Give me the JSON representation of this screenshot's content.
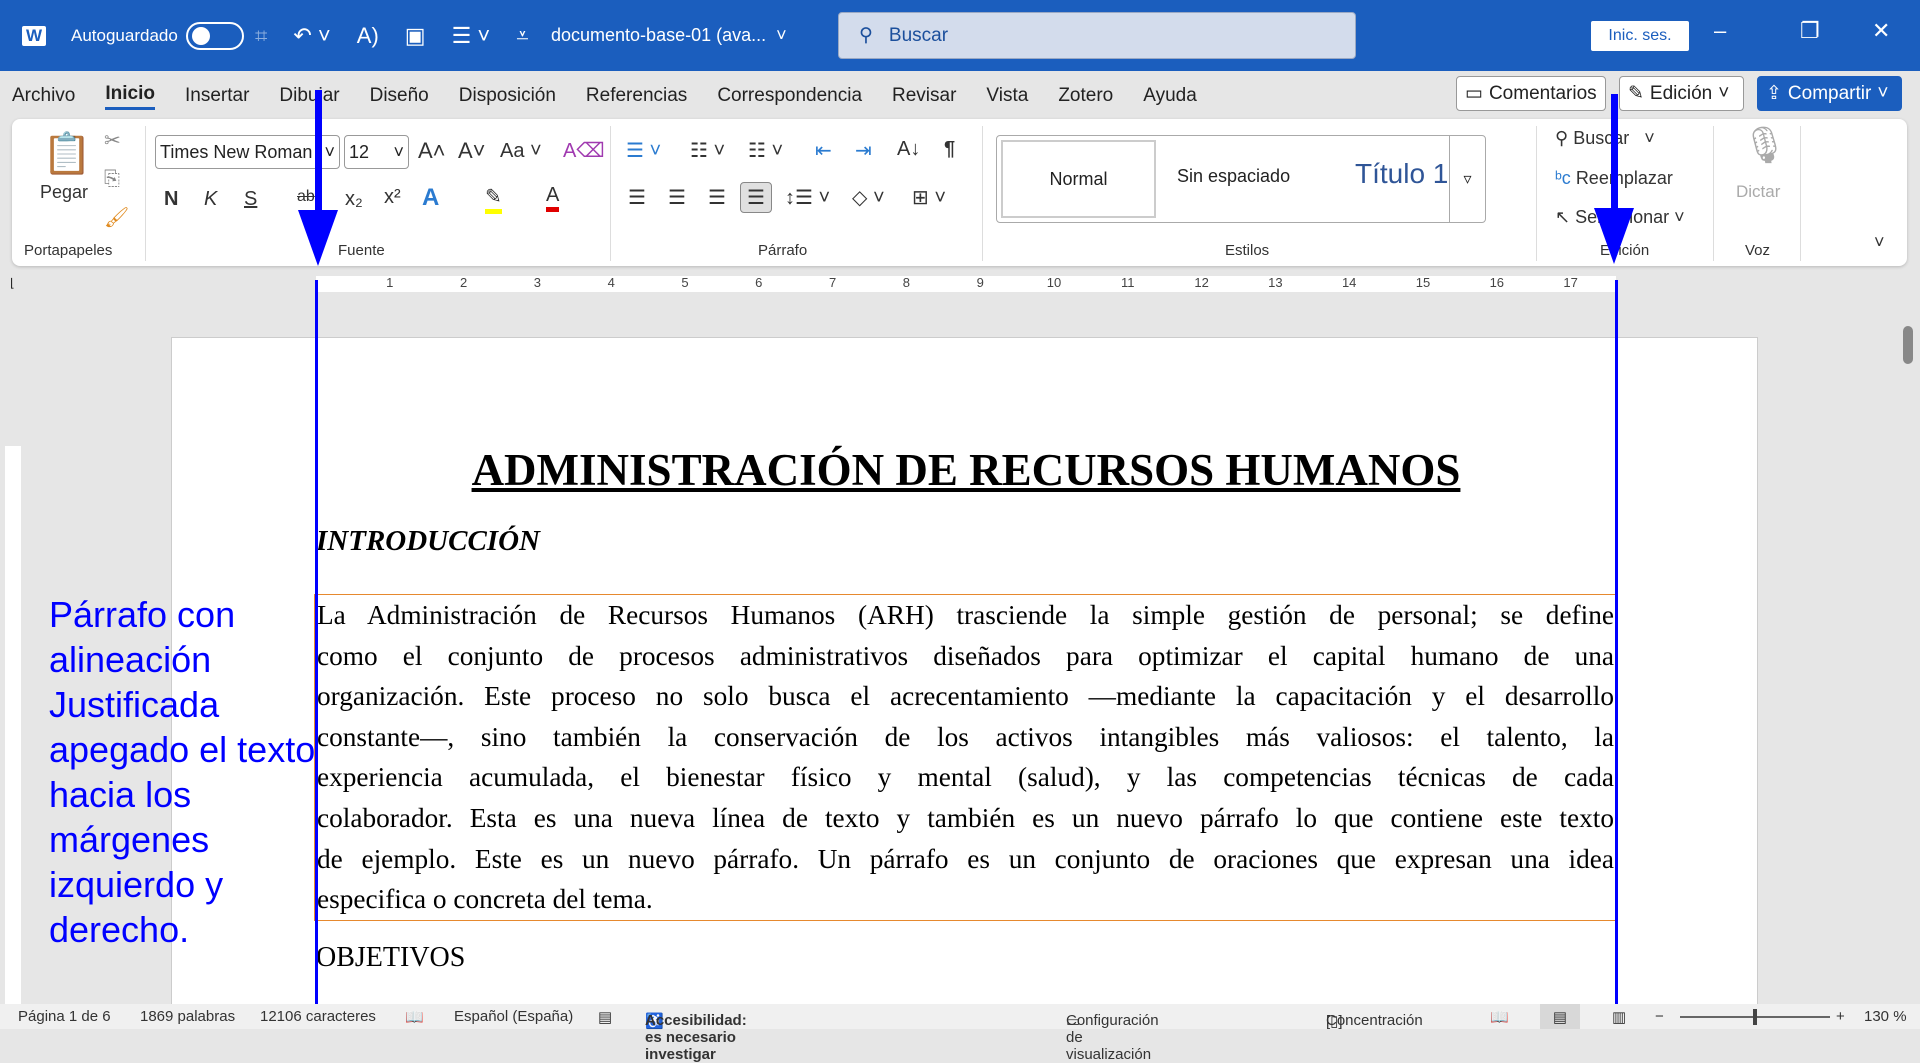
{
  "titlebar": {
    "autosave_label": "Autoguardado",
    "doc_title": "documento-base-01 (ava...",
    "search_placeholder": "Buscar",
    "signin": "Inic. ses.",
    "minimize": "–",
    "restore": "❐",
    "close": "✕"
  },
  "menu": {
    "tabs": [
      "Archivo",
      "Inicio",
      "Insertar",
      "Dibujar",
      "Diseño",
      "Disposición",
      "Referencias",
      "Correspondencia",
      "Revisar",
      "Vista",
      "Zotero",
      "Ayuda"
    ],
    "comments": "Comentarios",
    "editing": "Edición",
    "share": "Compartir"
  },
  "ribbon": {
    "paste": "Pegar",
    "font": "Times New Roman",
    "size": "12",
    "groups": {
      "clipboard": "Portapapeles",
      "font": "Fuente",
      "paragraph": "Párrafo",
      "styles": "Estilos",
      "editing": "Edición",
      "voice": "Voz"
    },
    "styles": [
      "Normal",
      "Sin espaciado",
      "Título 1"
    ],
    "find": "Buscar",
    "replace": "Reemplazar",
    "select": "Seleccionar",
    "dictate": "Dictar",
    "bold": "N",
    "italic": "K",
    "underline": "S",
    "strike": "ab",
    "sub": "x₂",
    "sup": "x²",
    "case": "Aa"
  },
  "ruler": [
    "1",
    "2",
    "3",
    "4",
    "5",
    "6",
    "7",
    "8",
    "9",
    "10",
    "11",
    "12",
    "13",
    "14",
    "15",
    "16",
    "17"
  ],
  "document": {
    "title": "ADMINISTRACIÓN DE RECURSOS HUMANOS",
    "intro": "INTRODUCCIÓN",
    "paragraph_lines": [
      "La Administración de Recursos Humanos (ARH) trasciende la simple gestión de personal; se define",
      "como el conjunto de procesos administrativos diseñados para optimizar el capital humano de una",
      "organización. Este proceso no solo busca el acrecentamiento —mediante la capacitación y el desarrollo",
      "constante—, sino también la conservación de los activos intangibles más valiosos: el talento, la",
      "experiencia acumulada, el bienestar físico y mental (salud), y las competencias técnicas de cada",
      "colaborador. Esta es una nueva línea de texto y también es un nuevo párrafo lo que contiene este texto",
      "de ejemplo. Este es un nuevo párrafo. Un párrafo es un conjunto de oraciones que expresan una idea",
      "especifica o concreta del tema."
    ],
    "objectives": "OBJETIVOS"
  },
  "annotation": "Párrafo con alineación Justificada apegado el texto hacia los márgenes izquierdo y derecho.",
  "status": {
    "page": "Página 1 de 6",
    "words": "1869 palabras",
    "chars": "12106 caracteres",
    "language": "Español (España)",
    "accessibility": "Accesibilidad: es necesario investigar",
    "display": "Configuración de visualización",
    "focus": "Concentración",
    "zoom": "130 %"
  },
  "colors": {
    "accent": "#1b5ebe",
    "annotation": "#0000ff",
    "paragraph_border": "#e6892e"
  }
}
